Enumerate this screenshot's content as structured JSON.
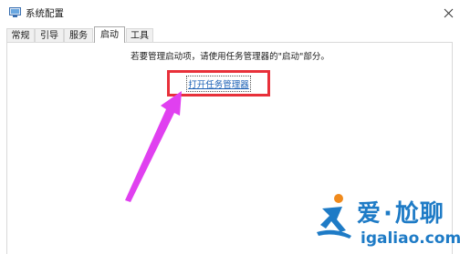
{
  "window": {
    "title": "系统配置",
    "icon": "system-config-icon",
    "close_icon": "close-icon"
  },
  "tabs": [
    {
      "label": "常规",
      "active": false
    },
    {
      "label": "引导",
      "active": false
    },
    {
      "label": "服务",
      "active": false
    },
    {
      "label": "启动",
      "active": true
    },
    {
      "label": "工具",
      "active": false
    }
  ],
  "startup": {
    "instruction": "若要管理启动项，请使用任务管理器的\"启动\"部分。",
    "task_manager_link": "打开任务管理器"
  },
  "annotation": {
    "arrow_color": "#e040f0",
    "box_color": "#e8303a"
  },
  "watermark": {
    "title_part1": "爱",
    "title_dot": "·",
    "title_part2": "尬聊",
    "domain": "igaliao.com",
    "color": "#1e7bc6",
    "accent": "#f08a1c"
  }
}
